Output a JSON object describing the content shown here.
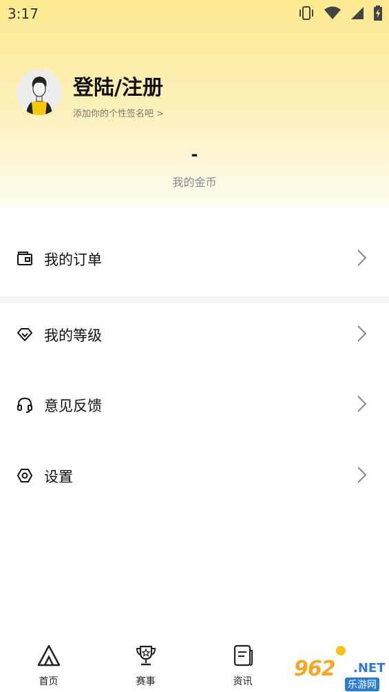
{
  "status_bar": {
    "time": "3:17"
  },
  "profile": {
    "name": "登陆/注册",
    "signature": "添加你的个性签名吧 >",
    "coins_value": "-",
    "coins_label": "我的金币"
  },
  "menu": {
    "items": [
      {
        "label": "我的订单",
        "icon": "wallet-icon"
      },
      {
        "label": "我的等级",
        "icon": "diamond-icon"
      },
      {
        "label": "意见反馈",
        "icon": "headset-icon"
      },
      {
        "label": "设置",
        "icon": "hexagon-settings-icon"
      }
    ]
  },
  "bottom_nav": {
    "items": [
      {
        "label": "首页",
        "icon": "home-logo-icon"
      },
      {
        "label": "赛事",
        "icon": "trophy-icon"
      },
      {
        "label": "资讯",
        "icon": "news-icon"
      }
    ]
  },
  "watermark": {
    "main": "962",
    "net": ".NET",
    "sub": "乐游网"
  },
  "colors": {
    "header_top": "#fde98f",
    "header_bottom": "#fffcf0",
    "divider": "#f4f4f6",
    "accent": "#f5c400"
  }
}
